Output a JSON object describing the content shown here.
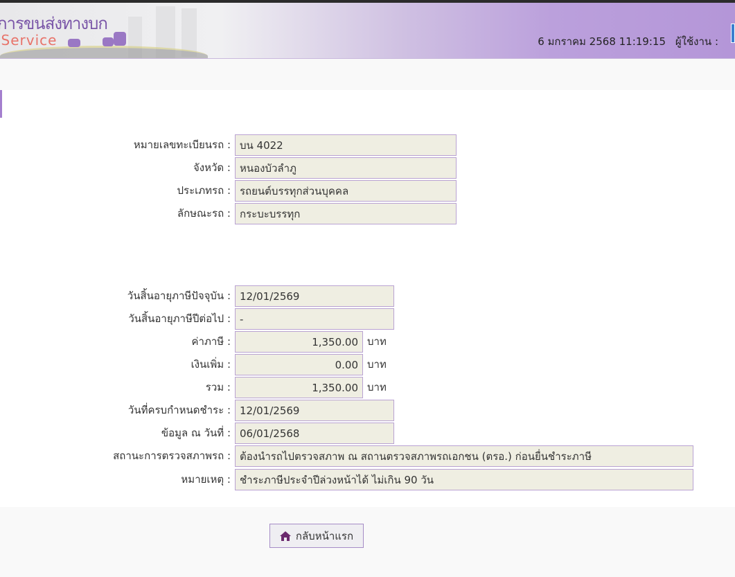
{
  "header": {
    "logo_th": "การขนส่งทางบก",
    "logo_en": "e-Service",
    "datetime": "6 มกราคม 2568 11:19:15",
    "user_label": "ผู้ใช้งาน :"
  },
  "vehicle": [
    {
      "label": "หมายเลขทะเบียนรถ :",
      "value": "บน 4022"
    },
    {
      "label": "จังหวัด :",
      "value": "หนองบัวลำภู"
    },
    {
      "label": "ประเภทรถ :",
      "value": "รถยนต์บรรทุกส่วนบุคคล"
    },
    {
      "label": "ลักษณะรถ :",
      "value": "กระบะบรรทุก"
    }
  ],
  "tax": {
    "current_expiry": {
      "label": "วันสิ้นอายุภาษีปัจจุบัน :",
      "value": "12/01/2569"
    },
    "next_expiry": {
      "label": "วันสิ้นอายุภาษีปีต่อไป :",
      "value": "-"
    },
    "tax_amount": {
      "label": "ค่าภาษี :",
      "value": "1,350.00",
      "unit": "บาท"
    },
    "surcharge": {
      "label": "เงินเพิ่ม :",
      "value": "0.00",
      "unit": "บาท"
    },
    "total": {
      "label": "รวม :",
      "value": "1,350.00",
      "unit": "บาท"
    },
    "due_date": {
      "label": "วันที่ครบกำหนดชำระ :",
      "value": "12/01/2569"
    },
    "data_as_of": {
      "label": "ข้อมูล ณ วันที่ :",
      "value": "06/01/2568"
    },
    "inspection_status": {
      "label": "สถานะการตรวจสภาพรถ :",
      "value": "ต้องนำรถไปตรวจสภาพ ณ สถานตรวจสภาพรถเอกชน (ตรอ.) ก่อนยื่นชำระภาษี"
    },
    "remark": {
      "label": "หมายเหตุ :",
      "value": "ชำระภาษีประจำปีล่วงหน้าได้ ไม่เกิน 90 วัน"
    }
  },
  "back_button": "กลับหน้าแรก"
}
